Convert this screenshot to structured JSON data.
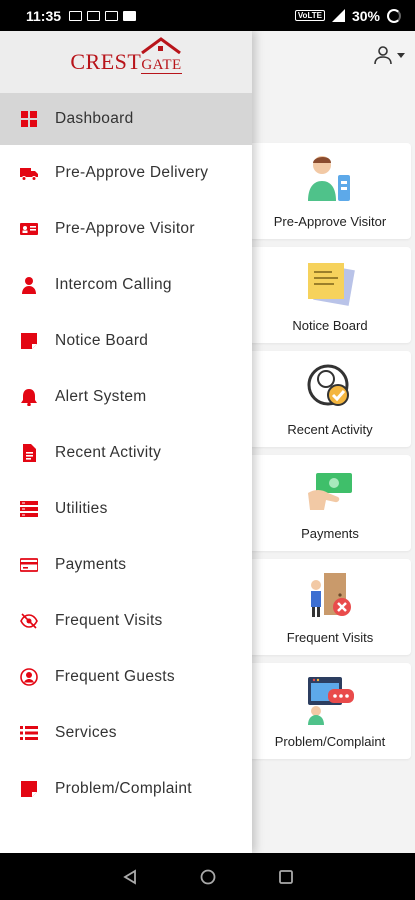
{
  "status_bar": {
    "time": "11:35",
    "network_label": "VoLTE",
    "battery": "30%"
  },
  "app": {
    "user_menu_icon": "user-icon"
  },
  "cards": [
    {
      "label": "Pre-Approve Visitor",
      "icon": "visitor-illustration-icon"
    },
    {
      "label": "Notice Board",
      "icon": "notice-note-illustration-icon"
    },
    {
      "label": "Recent Activity",
      "icon": "recent-activity-illustration-icon"
    },
    {
      "label": "Payments",
      "icon": "payments-illustration-icon"
    },
    {
      "label": "Frequent Visits",
      "icon": "frequent-visits-illustration-icon"
    },
    {
      "label": "Problem/Complaint",
      "icon": "complaint-illustration-icon"
    }
  ],
  "drawer": {
    "logo_main": "CREST",
    "logo_sub": "GATE",
    "items": [
      {
        "label": "Dashboard",
        "icon": "dashboard-icon",
        "active": true
      },
      {
        "label": "Pre-Approve Delivery",
        "icon": "truck-icon"
      },
      {
        "label": "Pre-Approve Visitor",
        "icon": "id-card-icon"
      },
      {
        "label": "Intercom Calling",
        "icon": "person-icon"
      },
      {
        "label": "Notice Board",
        "icon": "note-icon"
      },
      {
        "label": "Alert System",
        "icon": "bell-icon"
      },
      {
        "label": "Recent Activity",
        "icon": "document-icon"
      },
      {
        "label": "Utilities",
        "icon": "server-icon"
      },
      {
        "label": "Payments",
        "icon": "credit-card-icon"
      },
      {
        "label": "Frequent Visits",
        "icon": "eye-slash-icon"
      },
      {
        "label": "Frequent Guests",
        "icon": "user-circle-icon"
      },
      {
        "label": "Services",
        "icon": "list-icon"
      },
      {
        "label": "Problem/Complaint",
        "icon": "note-icon"
      }
    ]
  },
  "colors": {
    "accent": "#e30613",
    "active_bg": "#d6d6d6",
    "header_bg": "#ededed"
  }
}
